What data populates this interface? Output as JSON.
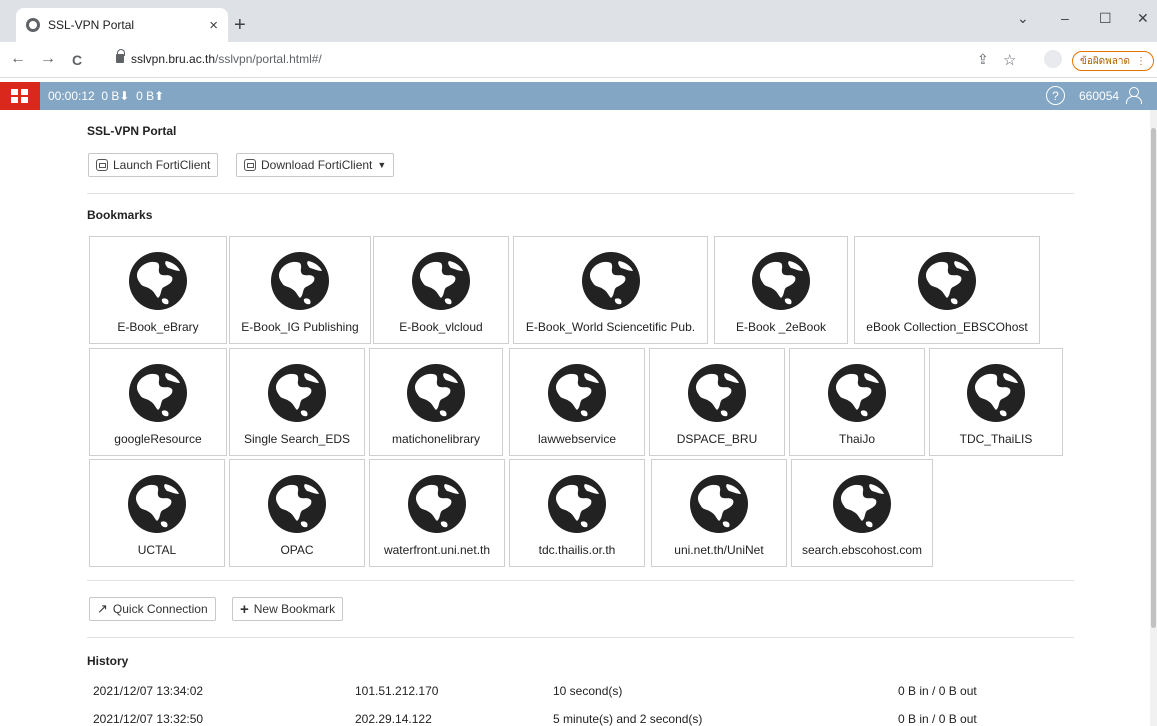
{
  "browser": {
    "tab_title": "SSL-VPN Portal",
    "tab_close": "×",
    "new_tab": "+",
    "url_host": "sslvpn.bru.ac.th",
    "url_path": "/sslvpn/portal.html#/",
    "update_label": "ข้อผิดพลาด",
    "update_menu": "⋮",
    "minimize": "–",
    "maximize": "☐",
    "close": "✕",
    "dropdown": "⌄",
    "back": "←",
    "forward": "→",
    "reload": "C",
    "share_icon": "⇪",
    "star_icon": "☆"
  },
  "header": {
    "timer": "00:00:12",
    "bytes_down": "0 B",
    "bytes_up": "0 B",
    "help": "?",
    "user": "660054"
  },
  "portal": {
    "title": "SSL-VPN Portal",
    "launch_label": "Launch FortiClient",
    "download_label": "Download FortiClient",
    "bookmarks_title": "Bookmarks",
    "quick_connection_label": "Quick Connection",
    "new_bookmark_label": "New Bookmark",
    "history_title": "History"
  },
  "bookmarks": [
    "E-Book_eBrary",
    "E-Book_IG Publishing",
    "E-Book_vlcloud",
    "E-Book_World Sciencetific Pub.",
    "E-Book _2eBook",
    "eBook Collection_EBSCOhost",
    "googleResource",
    "Single Search_EDS",
    "matichonelibrary",
    "lawwebservice",
    "DSPACE_BRU",
    "ThaiJo",
    "TDC_ThaiLIS",
    "UCTAL",
    "OPAC",
    "waterfront.uni.net.th",
    "tdc.thailis.or.th",
    "uni.net.th/UniNet",
    "search.ebscohost.com"
  ],
  "history": [
    {
      "time": "2021/12/07 13:34:02",
      "ip": "101.51.212.170",
      "duration": "10 second(s)",
      "traffic": "0 B in / 0 B out"
    },
    {
      "time": "2021/12/07 13:32:50",
      "ip": "202.29.14.122",
      "duration": "5 minute(s) and 2 second(s)",
      "traffic": "0 B in / 0 B out"
    }
  ]
}
